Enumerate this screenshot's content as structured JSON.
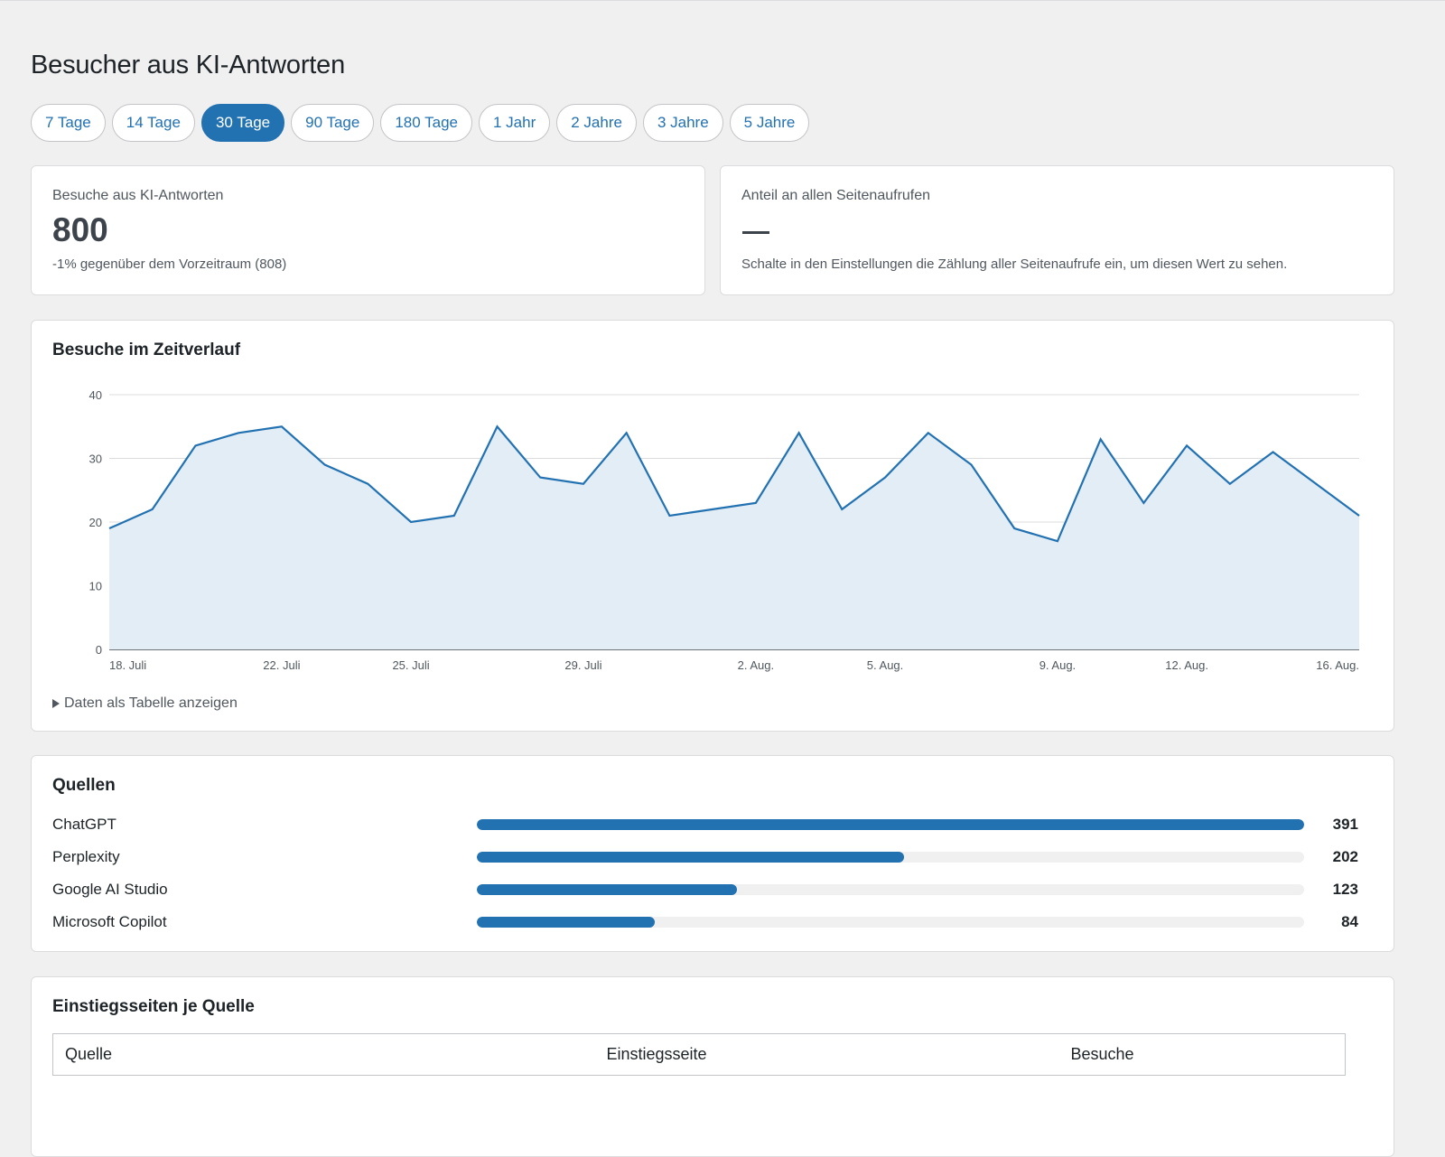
{
  "page": {
    "title": "Besucher aus KI-Antworten"
  },
  "tabs": [
    {
      "label": "7 Tage",
      "active": false
    },
    {
      "label": "14 Tage",
      "active": false
    },
    {
      "label": "30 Tage",
      "active": true
    },
    {
      "label": "90 Tage",
      "active": false
    },
    {
      "label": "180 Tage",
      "active": false
    },
    {
      "label": "1 Jahr",
      "active": false
    },
    {
      "label": "2 Jahre",
      "active": false
    },
    {
      "label": "3 Jahre",
      "active": false
    },
    {
      "label": "5 Jahre",
      "active": false
    }
  ],
  "stats": {
    "visits": {
      "label": "Besuche aus KI-Antworten",
      "value": "800",
      "note": "-1% gegenüber dem Vorzeitraum (808)"
    },
    "share": {
      "label": "Anteil an allen Seitenaufrufen",
      "value": "—",
      "note": "Schalte in den Einstellungen die Zählung aller Seitenaufrufe ein, um diesen Wert zu sehen."
    }
  },
  "chart_card": {
    "title": "Besuche im Zeitverlauf",
    "toggle_label": "Daten als Tabelle anzeigen"
  },
  "chart_data": {
    "type": "area",
    "x": [
      "18. Juli",
      "19. Juli",
      "20. Juli",
      "21. Juli",
      "22. Juli",
      "23. Juli",
      "24. Juli",
      "25. Juli",
      "26. Juli",
      "27. Juli",
      "28. Juli",
      "29. Juli",
      "30. Juli",
      "31. Juli",
      "1. Aug.",
      "2. Aug.",
      "3. Aug.",
      "4. Aug.",
      "5. Aug.",
      "6. Aug.",
      "7. Aug.",
      "8. Aug.",
      "9. Aug.",
      "10. Aug.",
      "11. Aug.",
      "12. Aug.",
      "13. Aug.",
      "14. Aug.",
      "15. Aug.",
      "16. Aug."
    ],
    "values": [
      19,
      22,
      32,
      34,
      35,
      29,
      26,
      20,
      21,
      35,
      27,
      26,
      34,
      21,
      22,
      23,
      34,
      22,
      27,
      34,
      29,
      19,
      17,
      33,
      23,
      32,
      26,
      31,
      26,
      21
    ],
    "tick_labels": [
      "18. Juli",
      "22. Juli",
      "25. Juli",
      "29. Juli",
      "2. Aug.",
      "5. Aug.",
      "9. Aug.",
      "12. Aug.",
      "16. Aug."
    ],
    "y_ticks": [
      0,
      10,
      20,
      30,
      40
    ],
    "ylim": [
      0,
      40
    ],
    "grid": true,
    "line_color": "#2271b1",
    "fill_color": "#e3edf6"
  },
  "sources": {
    "title": "Quellen",
    "items": [
      {
        "name": "ChatGPT",
        "value": 391
      },
      {
        "name": "Perplexity",
        "value": 202
      },
      {
        "name": "Google AI Studio",
        "value": 123
      },
      {
        "name": "Microsoft Copilot",
        "value": 84
      }
    ],
    "bar_color": "#2271b1"
  },
  "landing": {
    "title": "Einstiegsseiten je Quelle",
    "columns": [
      "Quelle",
      "Einstiegsseite",
      "Besuche"
    ]
  }
}
